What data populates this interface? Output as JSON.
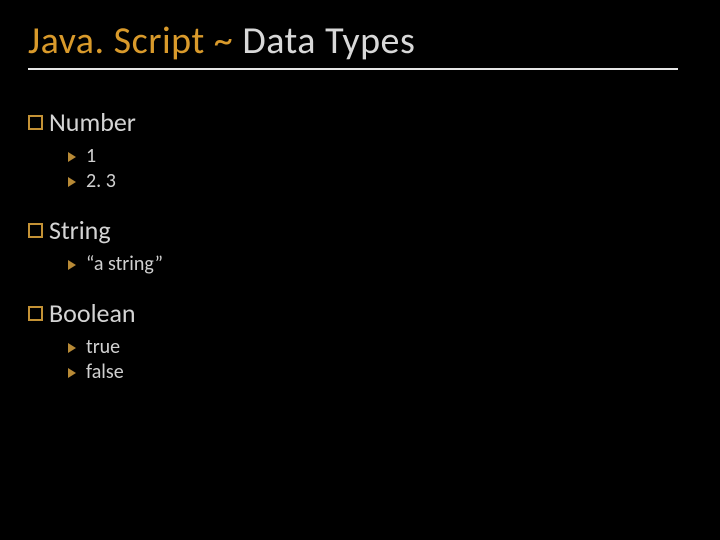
{
  "title": {
    "accent": "Java. Script ~ ",
    "main": "Data Types"
  },
  "sections": [
    {
      "heading": "Number",
      "items": [
        "1",
        "2. 3"
      ]
    },
    {
      "heading": "String",
      "items": [
        "“a string”"
      ]
    },
    {
      "heading": "Boolean",
      "items": [
        "true",
        "false"
      ]
    }
  ]
}
